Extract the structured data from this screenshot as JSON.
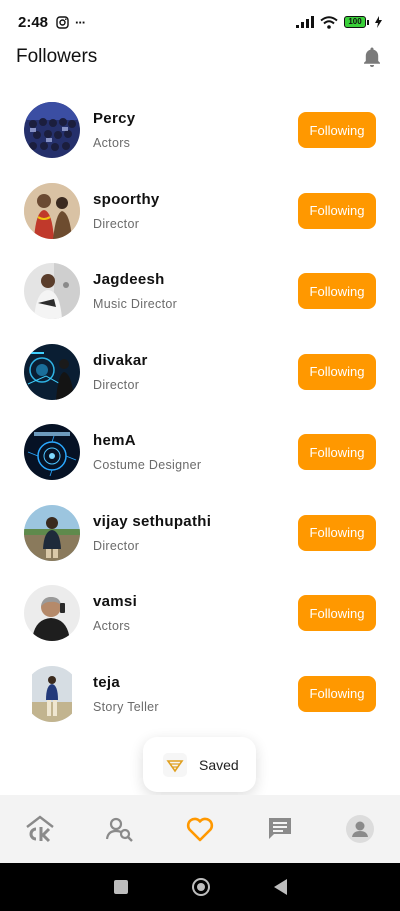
{
  "status_bar": {
    "time": "2:48",
    "more": "···",
    "battery": "100",
    "icons": [
      "instagram-icon",
      "signal-icon",
      "wifi-icon",
      "battery-icon",
      "charging-icon"
    ]
  },
  "header": {
    "title": "Followers",
    "icon": "bell-icon"
  },
  "followers": [
    {
      "name": "Percy",
      "role": "Actors",
      "button": "Following"
    },
    {
      "name": "spoorthy",
      "role": "Director",
      "button": "Following"
    },
    {
      "name": "Jagdeesh",
      "role": "Music Director",
      "button": "Following"
    },
    {
      "name": "divakar",
      "role": "Director",
      "button": "Following"
    },
    {
      "name": "hemA",
      "role": "Costume Designer",
      "button": "Following"
    },
    {
      "name": "vijay sethupathi",
      "role": "Director",
      "button": "Following"
    },
    {
      "name": "vamsi",
      "role": "Actors",
      "button": "Following"
    },
    {
      "name": "teja",
      "role": "Story Teller",
      "button": "Following"
    }
  ],
  "toast": {
    "message": "Saved"
  },
  "bottom_nav": [
    {
      "id": "home",
      "icon": "ck-home-icon"
    },
    {
      "id": "search-people",
      "icon": "person-search-icon"
    },
    {
      "id": "favorites",
      "icon": "heart-icon",
      "active": true
    },
    {
      "id": "messages",
      "icon": "chat-icon"
    },
    {
      "id": "profile",
      "icon": "profile-avatar-icon"
    }
  ],
  "colors": {
    "accent": "#ff9800",
    "text_primary": "#111111",
    "text_secondary": "#6b6b6b",
    "nav_background": "#f3f3f3",
    "icon_gray": "#8a8a8a"
  }
}
